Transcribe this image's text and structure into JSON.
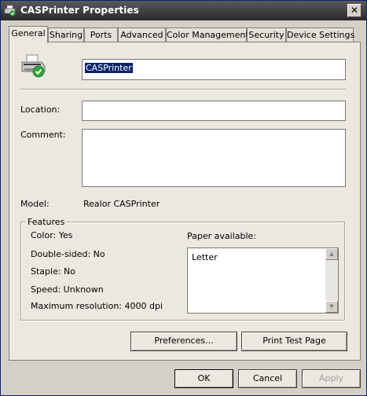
{
  "window": {
    "title": "CASPrinter Properties"
  },
  "tabs": [
    {
      "label": "General"
    },
    {
      "label": "Sharing"
    },
    {
      "label": "Ports"
    },
    {
      "label": "Advanced"
    },
    {
      "label": "Color Management"
    },
    {
      "label": "Security"
    },
    {
      "label": "Device Settings"
    }
  ],
  "general": {
    "printer_name": "CASPrinter",
    "location_label": "Location:",
    "location_value": "",
    "comment_label": "Comment:",
    "comment_value": "",
    "model_label": "Model:",
    "model_value": "Realor CASPrinter"
  },
  "features": {
    "legend": "Features",
    "color": "Color: Yes",
    "double_sided": "Double-sided: No",
    "staple": "Staple: No",
    "speed": "Speed: Unknown",
    "max_resolution": "Maximum resolution: 4000 dpi",
    "paper_label": "Paper available:",
    "paper_items": [
      "Letter"
    ]
  },
  "actions": {
    "preferences": "Preferences...",
    "print_test_page": "Print Test Page"
  },
  "dialog_buttons": {
    "ok": "OK",
    "cancel": "Cancel",
    "apply": "Apply"
  },
  "colors": {
    "dialog_bg": "#d4d0c8",
    "panel_bg": "#ebe8e0",
    "selection": "#0a246a"
  }
}
